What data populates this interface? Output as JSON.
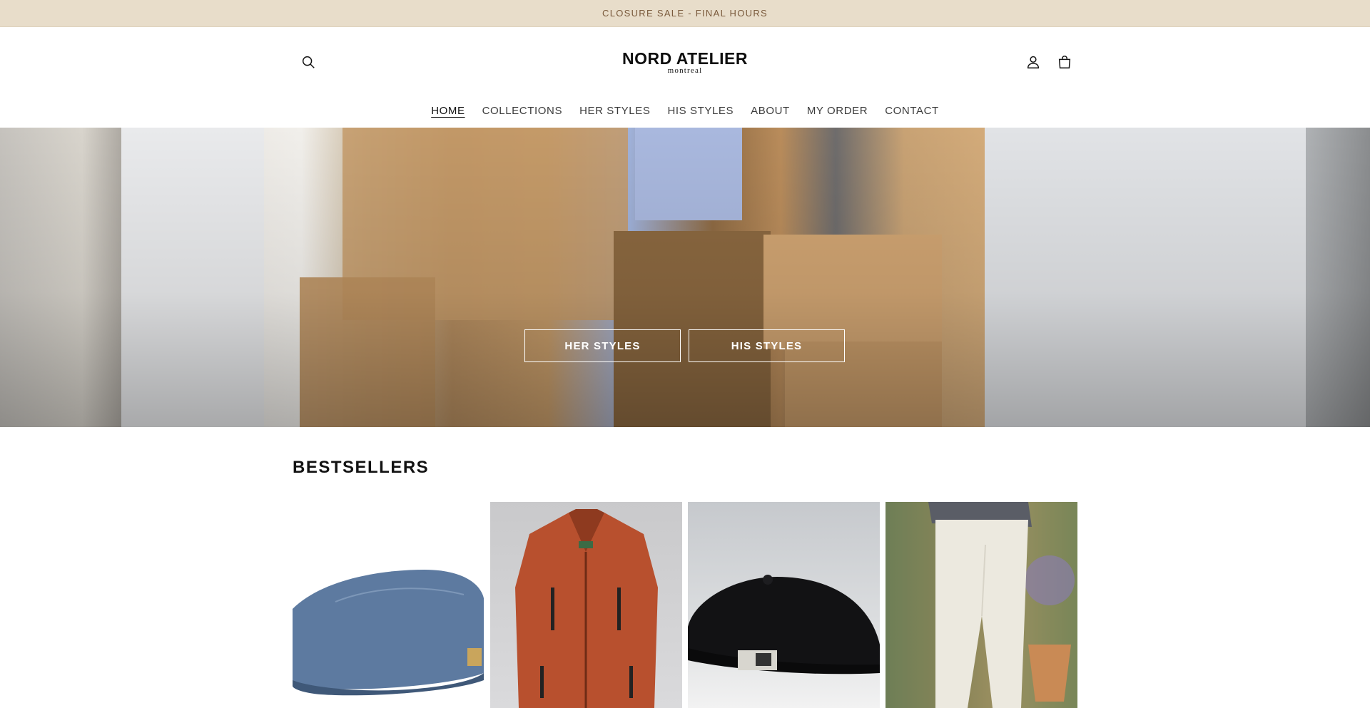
{
  "announcement": {
    "text": "CLOSURE SALE - FINAL HOURS"
  },
  "header": {
    "logo_main": "NORD ATELIER",
    "logo_sub": "montreal",
    "icons": [
      "search-icon",
      "account-icon",
      "cart-icon"
    ]
  },
  "nav": {
    "items": [
      {
        "label": "HOME",
        "active": true
      },
      {
        "label": "COLLECTIONS"
      },
      {
        "label": "HER STYLES"
      },
      {
        "label": "HIS STYLES"
      },
      {
        "label": "ABOUT"
      },
      {
        "label": "MY ORDER"
      },
      {
        "label": "CONTACT"
      }
    ]
  },
  "hero": {
    "buttons": [
      "HER STYLES",
      "HIS STYLES"
    ]
  },
  "bestsellers": {
    "title": "BESTSELLERS",
    "products": [
      {
        "image": "denim-flat-cap"
      },
      {
        "image": "orange-utility-vest"
      },
      {
        "image": "black-flat-cap"
      },
      {
        "image": "cream-linen-trousers"
      }
    ]
  },
  "colors": {
    "announcement_bg": "#e8ddca",
    "announcement_text": "#7a5a3c",
    "text": "#121212"
  }
}
